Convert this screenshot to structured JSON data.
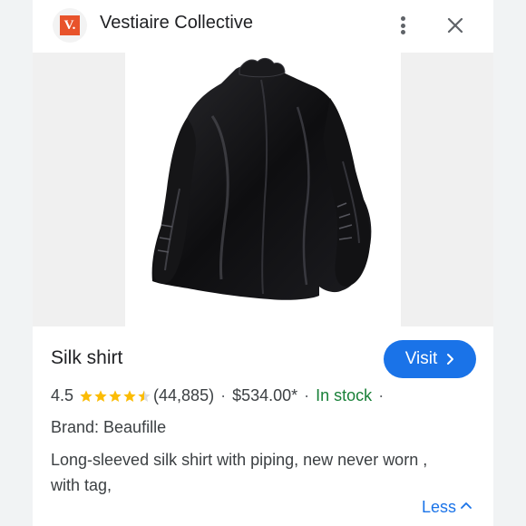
{
  "header": {
    "logo_letter": "V.",
    "logo_color": "#e8532b",
    "site_name": "Vestiaire Collective",
    "more_icon": "more-vert-icon",
    "close_icon": "close-icon"
  },
  "product": {
    "image_alt": "black silk shirt product photo",
    "title": "Silk shirt",
    "visit_label": "Visit",
    "rating": "4.5",
    "rating_value": 4.5,
    "rating_max": 5,
    "reviews": "(44,885)",
    "separator": "·",
    "price": "$534.00*",
    "stock": "In stock",
    "brand": "Brand: Beaufille",
    "description": "Long-sleeved silk shirt with piping, new never worn , with tag,",
    "less_label": "Less"
  },
  "colors": {
    "accent": "#1a73e8",
    "stock": "#188038",
    "star": "#fbbc04"
  }
}
